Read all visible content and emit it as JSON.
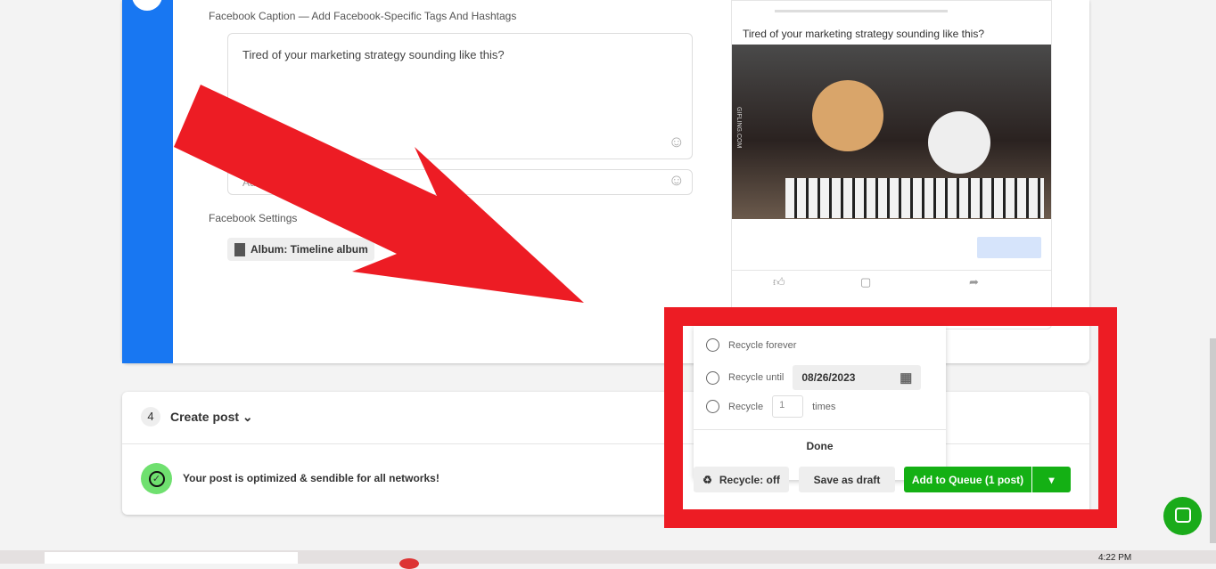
{
  "facebook": {
    "caption_label": "Facebook Caption — Add Facebook-Specific Tags And Hashtags",
    "caption_text": "Tired of your marketing strategy sounding like this?",
    "comment_placeholder": "Ad",
    "settings_label": "Facebook Settings",
    "album_chip": "Album: Timeline album"
  },
  "preview": {
    "text": "Tired of your marketing strategy sounding like this?",
    "watermark": "GIFLING.COM"
  },
  "create_post": {
    "step": "4",
    "title": "Create post",
    "status": "Your post is optimized & sendible for all networks!"
  },
  "recycle_popup": {
    "forever": "Recycle forever",
    "until": "Recycle until",
    "until_date": "08/26/2023",
    "recycle": "Recycle",
    "times_value": "1",
    "times": "times",
    "done": "Done"
  },
  "actions": {
    "recycle": "Recycle: off",
    "save_draft": "Save as draft",
    "add_queue": "Add to Queue (1 post)"
  },
  "taskbar": {
    "time": "4:22 PM"
  },
  "colors": {
    "facebook": "#1877f2",
    "primary": "#14b014",
    "annotation": "#ed1c24"
  }
}
